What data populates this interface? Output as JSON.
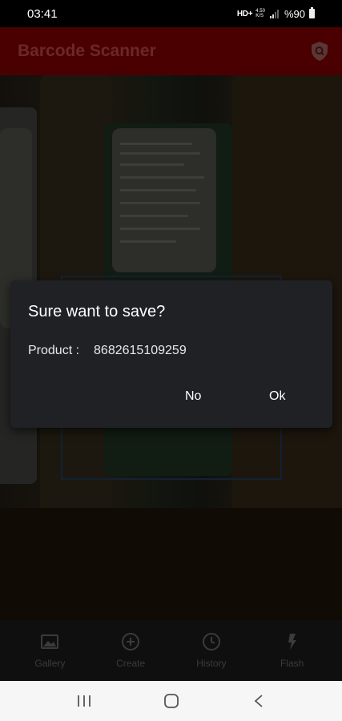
{
  "status_bar": {
    "time": "03:41",
    "network": "HD+",
    "net_speed_top": "4.50",
    "net_speed_bottom": "K/S",
    "battery": "%90"
  },
  "app_bar": {
    "title": "Barcode Scanner",
    "action_icon": "shield-search-icon"
  },
  "dialog": {
    "title": "Sure want to save?",
    "product_label": "Product :",
    "product_value": "8682615109259",
    "no_label": "No",
    "ok_label": "Ok"
  },
  "bottom_nav": {
    "items": [
      {
        "label": "Gallery",
        "icon": "gallery-icon"
      },
      {
        "label": "Create",
        "icon": "add-circle-icon"
      },
      {
        "label": "History",
        "icon": "clock-icon"
      },
      {
        "label": "Flash",
        "icon": "flash-icon"
      }
    ]
  },
  "system_nav": {
    "buttons": [
      "recent-apps-icon",
      "home-icon",
      "back-icon"
    ]
  },
  "colors": {
    "app_bar": "#4a0000",
    "dialog_bg": "#202124",
    "scan_frame": "#1c3550"
  }
}
